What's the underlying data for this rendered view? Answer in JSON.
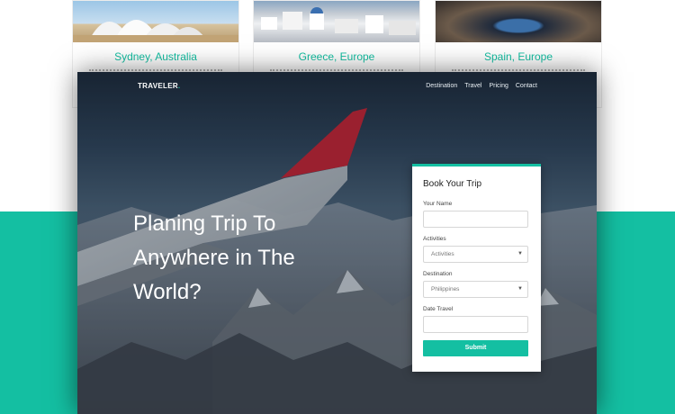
{
  "background_page": {
    "destinations": [
      {
        "title": "Sydney, Australia",
        "photo": "sydney-opera-house-photo"
      },
      {
        "title": "Greece, Europe",
        "photo": "santorini-village-photo"
      },
      {
        "title": "Spain, Europe",
        "photo": "pool-night-photo"
      }
    ]
  },
  "preview": {
    "brand": "TRAVELER",
    "brand_dot": ".",
    "nav": [
      "Destination",
      "Travel",
      "Pricing",
      "Contact"
    ],
    "hero": {
      "line1": "Planing Trip To",
      "line2": "Anywhere in The",
      "line3": "World?"
    },
    "booking": {
      "title": "Book Your Trip",
      "fields": {
        "name_label": "Your Name",
        "activities_label": "Activities",
        "activities_value": "Activities",
        "destination_label": "Destination",
        "destination_value": "Philippines",
        "date_label": "Date Travel"
      },
      "submit_label": "Submit"
    }
  },
  "colors": {
    "accent": "#14bfa2",
    "wing_tip": "#c8202f"
  }
}
